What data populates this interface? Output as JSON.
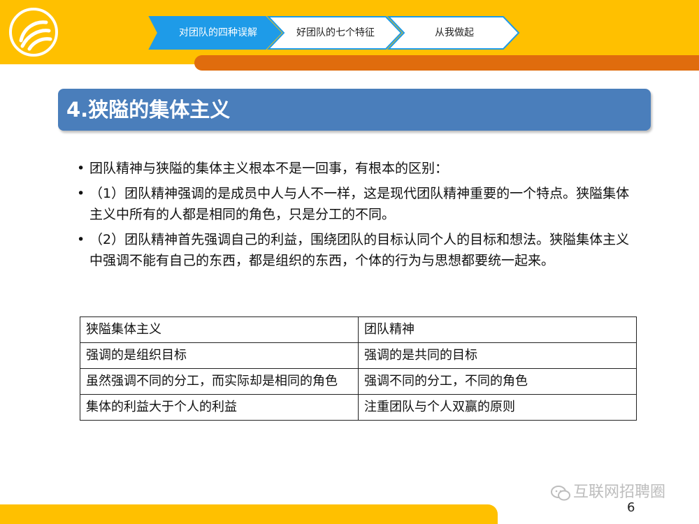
{
  "header": {
    "nav_steps": [
      {
        "label": "对团队的四种误解",
        "active": true
      },
      {
        "label": "好团队的七个特征",
        "active": false
      },
      {
        "label": "从我做起",
        "active": false
      }
    ]
  },
  "title": "4.狭隘的集体主义",
  "bullets": [
    "团队精神与狭隘的集体主义根本不是一回事，有根本的区别：",
    "（1）团队精神强调的是成员中人与人不一样，这是现代团队精神重要的一个特点。狭隘集体主义中所有的人都是相同的角色，只是分工的不同。",
    "（2）团队精神首先强调自己的利益，围绕团队的目标认同个人的目标和想法。狭隘集体主义中强调不能有自己的东西，都是组织的东西，个体的行为与思想都要统一起来。"
  ],
  "table": {
    "rows": [
      [
        "狭隘集体主义",
        "团队精神"
      ],
      [
        "强调的是组织目标",
        "强调的是共同的目标"
      ],
      [
        "虽然强调不同的分工，而实际却是相同的角色",
        "强调不同的分工，不同的角色"
      ],
      [
        "集体的利益大于个人的利益",
        "注重团队与个人双赢的原则"
      ]
    ]
  },
  "page_number": "6",
  "watermark": "互联网招聘圈",
  "colors": {
    "header_yellow": "#FFC000",
    "header_orange": "#E06C0D",
    "nav_active": "#1E9BE8",
    "title_blue": "#4A7EBB"
  }
}
